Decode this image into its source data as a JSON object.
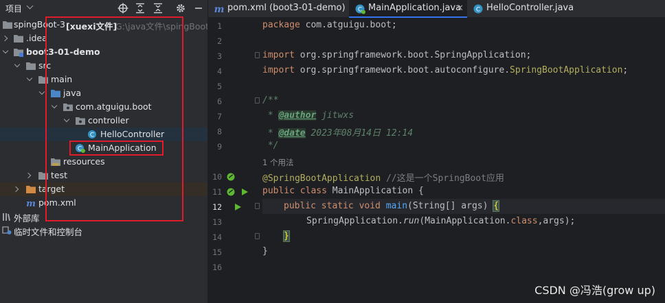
{
  "project_panel": {
    "title": "项目",
    "tree": [
      {
        "name": "tree-item-springboot3",
        "label": "spingBoot-3",
        "extra": "[xuexi文件]",
        "path": "G:\\java文件\\spingBoot-"
      },
      {
        "name": "tree-item-idea",
        "label": ".idea"
      },
      {
        "name": "tree-item-boot3-01-demo",
        "label": "boot3-01-demo"
      },
      {
        "name": "tree-item-src",
        "label": "src"
      },
      {
        "name": "tree-item-main",
        "label": "main"
      },
      {
        "name": "tree-item-java",
        "label": "java"
      },
      {
        "name": "tree-item-package",
        "label": "com.atguigu.boot"
      },
      {
        "name": "tree-item-controller",
        "label": "controller"
      },
      {
        "name": "tree-item-hellocontroller",
        "label": "HelloController"
      },
      {
        "name": "tree-item-mainapplication",
        "label": "MainApplication"
      },
      {
        "name": "tree-item-resources",
        "label": "resources"
      },
      {
        "name": "tree-item-test",
        "label": "test"
      },
      {
        "name": "tree-item-target",
        "label": "target"
      },
      {
        "name": "tree-item-pom",
        "label": "pom.xml"
      },
      {
        "name": "tree-item-external-libs",
        "label": "外部库"
      },
      {
        "name": "tree-item-scratches",
        "label": "临时文件和控制台"
      }
    ]
  },
  "tabs": [
    {
      "label": "pom.xml (boot3-01-demo)",
      "icon": "maven-icon"
    },
    {
      "label": "MainApplication.java",
      "icon": "spring-class-icon"
    },
    {
      "label": "HelloController.java",
      "icon": "class-icon"
    }
  ],
  "code": {
    "line_numbers": [
      "1",
      "2",
      "3",
      "4",
      "5",
      "6",
      "7",
      "8",
      "9",
      "",
      "10",
      "11",
      "12",
      "13",
      "14",
      "15",
      "16"
    ],
    "package_kw": "package",
    "package_name": " com.atguigu.boot;",
    "import_kw": "import",
    "import1": " org.springframework.boot.SpringApplication;",
    "import2_prefix": " org.springframework.boot.autoconfigure.",
    "import2_ann": "SpringBootApplication",
    "import2_end": ";",
    "doc_open": "/**",
    "doc_star": " * ",
    "author_tag": "@author",
    "author_value": " jitwxs",
    "date_tag": "@date",
    "date_value": " 2023年08月14日 12:14",
    "doc_close": " */",
    "usage_hint": "1 个用法",
    "annotation": "@SpringBootApplication",
    "annotation_comment": " //这是一个SpringBoot应用",
    "class_kw": "public class",
    "class_name": " MainApplication {",
    "method_kw": "public static void",
    "method_name": "main",
    "method_params": "(String[] args) ",
    "brace_open": "{",
    "call_obj": "SpringApplication.",
    "call_method": "run",
    "call_args": "(MainApplication.",
    "call_class_kw": "class",
    "call_end": ",args);",
    "brace_close_method": "}",
    "brace_close_class": "}"
  },
  "watermark": "CSDN @冯浩(grow up)",
  "colors": {
    "highlight_box": "#e01c2c",
    "accent": "#3574f0"
  }
}
